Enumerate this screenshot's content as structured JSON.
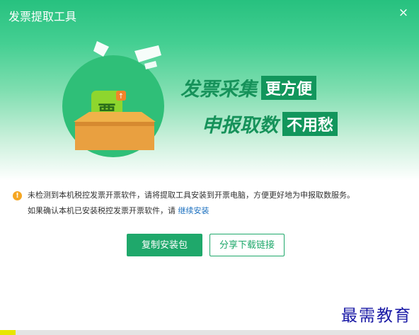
{
  "window": {
    "title": "发票提取工具",
    "close_label": "×"
  },
  "banner": {
    "slogan_line1_main": "发票采集",
    "slogan_line1_tag": "更方便",
    "slogan_line2_main": "申报取数",
    "slogan_line2_tag": "不用愁",
    "app_icon_char": "票"
  },
  "notice": {
    "icon": "warning-icon",
    "line1": "未检测到本机税控发票开票软件，请将提取工具安装到开票电脑，方便更好地为申报取数服务。",
    "line2_prefix": "如果确认本机已安装税控发票开票软件，请",
    "line2_link": "继续安装"
  },
  "buttons": {
    "copy_package": "复制安装包",
    "share_link": "分享下载链接"
  },
  "watermark": "最需教育",
  "colors": {
    "brand_green": "#1fa86b",
    "slogan_green": "#16925a",
    "link_blue": "#1a6fbf",
    "warning_orange": "#f5a623"
  }
}
